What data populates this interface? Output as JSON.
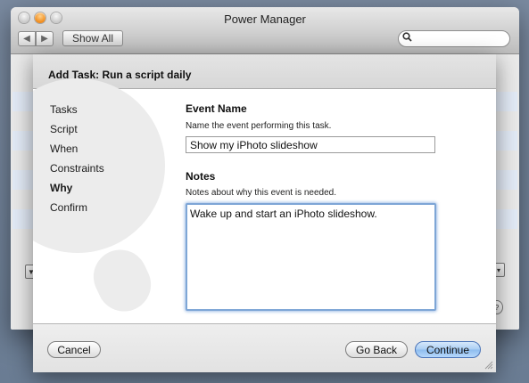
{
  "window": {
    "title": "Power Manager",
    "show_all_label": "Show All",
    "search_placeholder": ""
  },
  "sheet": {
    "title": "Add Task: Run a script daily",
    "steps": [
      {
        "label": "Tasks",
        "active": false
      },
      {
        "label": "Script",
        "active": false
      },
      {
        "label": "When",
        "active": false
      },
      {
        "label": "Constraints",
        "active": false
      },
      {
        "label": "Why",
        "active": true
      },
      {
        "label": "Confirm",
        "active": false
      }
    ],
    "event_name": {
      "heading": "Event Name",
      "description": "Name the event performing this task.",
      "value": "Show my iPhoto slideshow"
    },
    "notes": {
      "heading": "Notes",
      "description": "Notes about why this event is needed.",
      "value": "Wake up and start an iPhoto slideshow."
    },
    "buttons": {
      "cancel": "Cancel",
      "go_back": "Go Back",
      "continue": "Continue"
    }
  },
  "colors": {
    "desktop": "#6f8197",
    "focus_ring": "#7ea6d6",
    "default_button": "#a9cdf3",
    "list_stripe": "#e3ebf7"
  }
}
